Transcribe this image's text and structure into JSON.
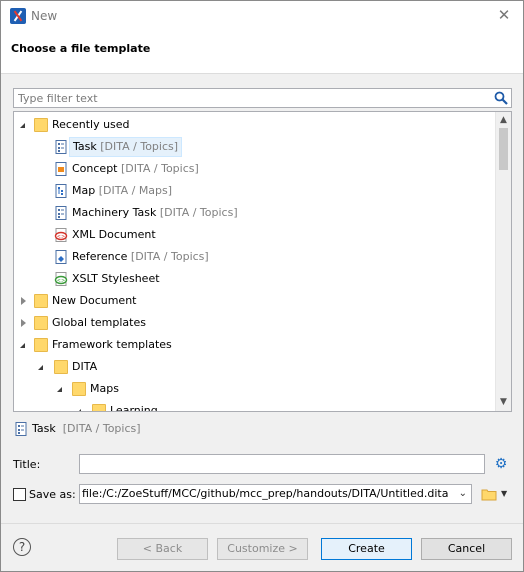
{
  "window": {
    "title": "New"
  },
  "header": {
    "title": "Choose a file template"
  },
  "filter": {
    "placeholder": "Type filter text"
  },
  "tree": {
    "recently_used": "Recently used",
    "items": [
      {
        "name": "Task",
        "category": "[DITA / Topics]",
        "icon": "dita-task-icon"
      },
      {
        "name": "Concept",
        "category": "[DITA / Topics]",
        "icon": "dita-concept-icon"
      },
      {
        "name": "Map",
        "category": "[DITA / Maps]",
        "icon": "dita-map-icon"
      },
      {
        "name": "Machinery Task",
        "category": "[DITA / Topics]",
        "icon": "dita-task-icon"
      },
      {
        "name": "XML Document",
        "category": "",
        "icon": "xml-document-icon"
      },
      {
        "name": "Reference",
        "category": "[DITA / Topics]",
        "icon": "dita-reference-icon"
      },
      {
        "name": "XSLT Stylesheet",
        "category": "",
        "icon": "xslt-icon"
      }
    ],
    "new_document": "New Document",
    "global_templates": "Global templates",
    "framework_templates": "Framework templates",
    "dita": "DITA",
    "maps": "Maps",
    "learning": "Learning"
  },
  "selection": {
    "name": "Task",
    "category": "[DITA / Topics]"
  },
  "form": {
    "title_label": "Title:",
    "title_value": "",
    "saveas_label": "Save as:",
    "saveas_value": "file:/C:/ZoeStuff/MCC/github/mcc_prep/handouts/DITA/Untitled.dita",
    "saveas_checked": false
  },
  "buttons": {
    "back": "< Back",
    "customize": "Customize >",
    "create": "Create",
    "cancel": "Cancel"
  },
  "colors": {
    "selection_bg": "#e5f1fb",
    "category_text": "#808080",
    "accent": "#0078d7"
  }
}
